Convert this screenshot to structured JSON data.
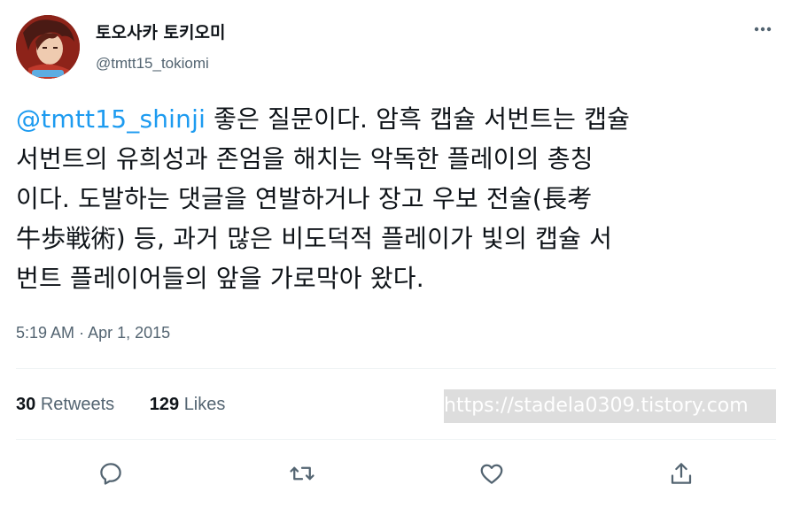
{
  "author": {
    "display_name": "토오사카 토키오미",
    "handle": "@tmtt15_tokiomi"
  },
  "tweet": {
    "mention": "@tmtt15_shinji",
    "line1_rest": " 좋은 질문이다. 암흑 캡슐 서번트는 캡슐",
    "line2": "서번트의 유희성과 존엄을 해치는 악독한 플레이의 총칭",
    "line3": "이다. 도발하는 댓글을 연발하거나 장고 우보 전술(長考",
    "line4": "牛歩戦術) 등, 과거 많은 비도덕적 플레이가 빛의 캡슐 서",
    "line5": "번트 플레이어들의 앞을 가로막아 왔다."
  },
  "meta": {
    "time": "5:19 AM",
    "separator": "·",
    "date": "Apr 1, 2015"
  },
  "stats": {
    "retweets_count": "30",
    "retweets_label": "Retweets",
    "likes_count": "129",
    "likes_label": "Likes"
  },
  "watermark": "https://stadela0309.tistory.com",
  "icons": {
    "more": "more-horizontal-icon",
    "reply": "reply-icon",
    "retweet": "retweet-icon",
    "like": "heart-icon",
    "share": "share-icon"
  },
  "colors": {
    "accent": "#1d9bf0",
    "secondary_text": "#536471",
    "primary_text": "#0f1419",
    "divider": "#eff3f4"
  }
}
